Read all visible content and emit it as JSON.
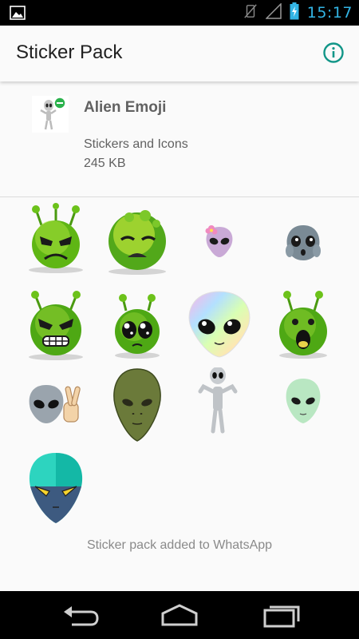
{
  "status_bar": {
    "time": "15:17",
    "icons": [
      "image-notification-icon",
      "vibrate-off-icon",
      "signal-icon",
      "battery-icon"
    ]
  },
  "app_bar": {
    "title": "Sticker Pack",
    "info_icon": "info-icon",
    "accent_color": "#129688"
  },
  "pack": {
    "name": "Alien Emoji",
    "publisher": "Stickers and Icons",
    "size": "245 KB"
  },
  "stickers": [
    {
      "name": "angry-green-alien"
    },
    {
      "name": "sad-green-alien"
    },
    {
      "name": "flower-purple-alien"
    },
    {
      "name": "screaming-gray-alien"
    },
    {
      "name": "furious-green-alien"
    },
    {
      "name": "teary-green-alien"
    },
    {
      "name": "rainbow-alien"
    },
    {
      "name": "shocked-green-alien"
    },
    {
      "name": "peace-sign-alien"
    },
    {
      "name": "olive-alien-head"
    },
    {
      "name": "gray-alien-figure"
    },
    {
      "name": "mint-alien-head"
    },
    {
      "name": "teal-alien-head"
    }
  ],
  "footer": {
    "status_text": "Sticker pack added to WhatsApp"
  },
  "nav_bar": {
    "icons": [
      "back-icon",
      "home-icon",
      "recents-icon"
    ]
  }
}
